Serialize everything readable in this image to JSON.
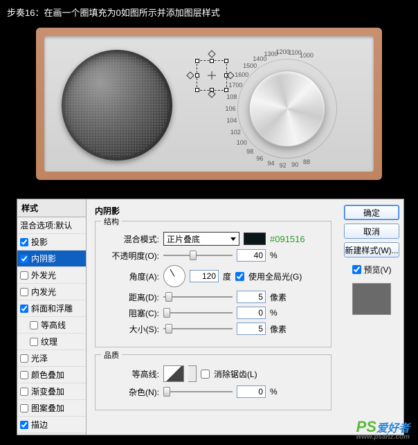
{
  "caption": "步奏16：在画一个圈填充为0如图所示并添加图层样式",
  "dial_numbers": [
    "88",
    "90",
    "92",
    "94",
    "96",
    "98",
    "100",
    "102",
    "104",
    "106",
    "108",
    "1700",
    "1600",
    "1500",
    "1400",
    "1300",
    "1200",
    "1100",
    "1000"
  ],
  "dialog": {
    "styles_header": "样式",
    "blend_options": "混合选项:默认",
    "items": [
      {
        "label": "投影",
        "checked": true
      },
      {
        "label": "内阴影",
        "checked": true,
        "selected": true
      },
      {
        "label": "外发光",
        "checked": false
      },
      {
        "label": "内发光",
        "checked": false
      },
      {
        "label": "斜面和浮雕",
        "checked": true
      },
      {
        "label": "等高线",
        "checked": false,
        "indent": true
      },
      {
        "label": "纹理",
        "checked": false,
        "indent": true
      },
      {
        "label": "光泽",
        "checked": false
      },
      {
        "label": "颜色叠加",
        "checked": false
      },
      {
        "label": "渐变叠加",
        "checked": false
      },
      {
        "label": "图案叠加",
        "checked": false
      },
      {
        "label": "描边",
        "checked": true
      }
    ],
    "panel_title": "内阴影",
    "group_structure": "结构",
    "group_quality": "品质",
    "blend_mode_label": "混合模式:",
    "blend_mode_value": "正片叠底",
    "color_hex": "#091516",
    "opacity_label": "不透明度(O):",
    "opacity_value": "40",
    "percent": "%",
    "angle_label": "角度(A):",
    "angle_value": "120",
    "degree": "度",
    "global_light_label": "使用全局光(G)",
    "global_light_checked": true,
    "distance_label": "距离(D):",
    "distance_value": "5",
    "px": "像素",
    "choke_label": "阻塞(C):",
    "choke_value": "0",
    "size_label": "大小(S):",
    "size_value": "5",
    "contour_label": "等高线:",
    "antialias_label": "消除锯齿(L)",
    "antialias_checked": false,
    "noise_label": "杂色(N):",
    "noise_value": "0",
    "buttons": {
      "ok": "确定",
      "cancel": "取消",
      "new_style": "新建样式(W)...",
      "preview": "预览(V)"
    }
  },
  "watermark": {
    "brand": "PS",
    "suffix": "爱好者",
    "url": "www.psahz.com"
  }
}
